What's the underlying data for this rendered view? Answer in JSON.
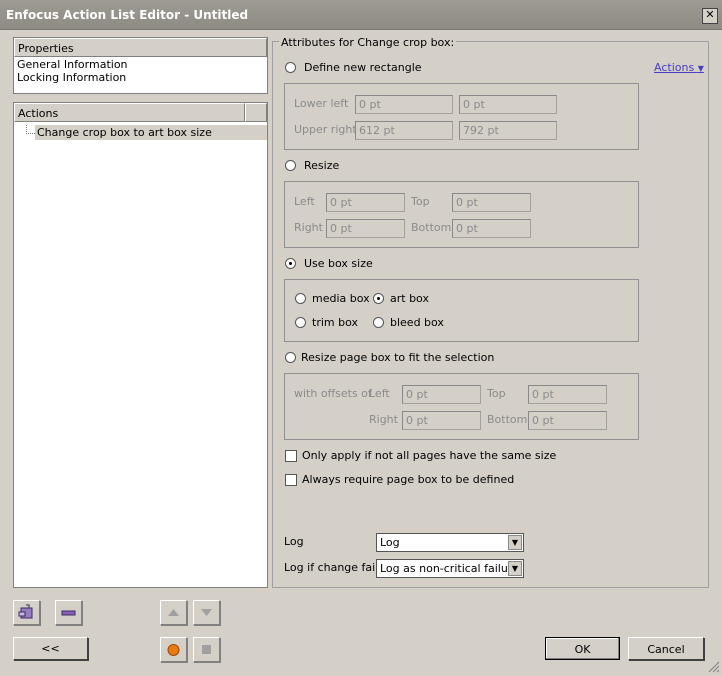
{
  "window": {
    "title": "Enfocus Action List Editor - Untitled"
  },
  "properties": {
    "header": "Properties",
    "items": [
      "General Information",
      "Locking Information"
    ]
  },
  "actions_panel": {
    "header": "Actions",
    "items": [
      "Change crop box to art box size"
    ]
  },
  "attributes": {
    "title": "Attributes for Change crop box:",
    "actions_link": "Actions",
    "define_rect": {
      "label": "Define new rectangle",
      "lower_left": "Lower left",
      "upper_right": "Upper right",
      "ll_x": "0 pt",
      "ll_y": "0 pt",
      "ur_x": "612 pt",
      "ur_y": "792 pt"
    },
    "resize": {
      "label": "Resize",
      "left": "Left",
      "top": "Top",
      "right": "Right",
      "bottom": "Bottom",
      "left_val": "0 pt",
      "top_val": "0 pt",
      "right_val": "0 pt",
      "bottom_val": "0 pt"
    },
    "use_box": {
      "label": "Use box size",
      "media": "media box",
      "art": "art box",
      "trim": "trim box",
      "bleed": "bleed box",
      "selected": "art box"
    },
    "fit_sel": {
      "label": "Resize page box to fit the selection",
      "with_offsets": "with offsets of",
      "left": "Left",
      "top": "Top",
      "right": "Right",
      "bottom": "Bottom",
      "left_val": "0 pt",
      "top_val": "0 pt",
      "right_val": "0 pt",
      "bottom_val": "0 pt"
    },
    "check_same_size": "Only apply if not all pages have the same size",
    "check_require": "Always require page box to be defined",
    "log_label": "Log",
    "log_value": "Log",
    "log_fail_label": "Log if change fails",
    "log_fail_value": "Log as non-critical failure",
    "selected_mode": "Use box size"
  },
  "buttons": {
    "back": "<<",
    "ok": "OK",
    "cancel": "Cancel"
  },
  "colors": {
    "accent_link": "#4a3cc8",
    "record_button": "#e87a14",
    "selection": "#d4d0c8"
  }
}
